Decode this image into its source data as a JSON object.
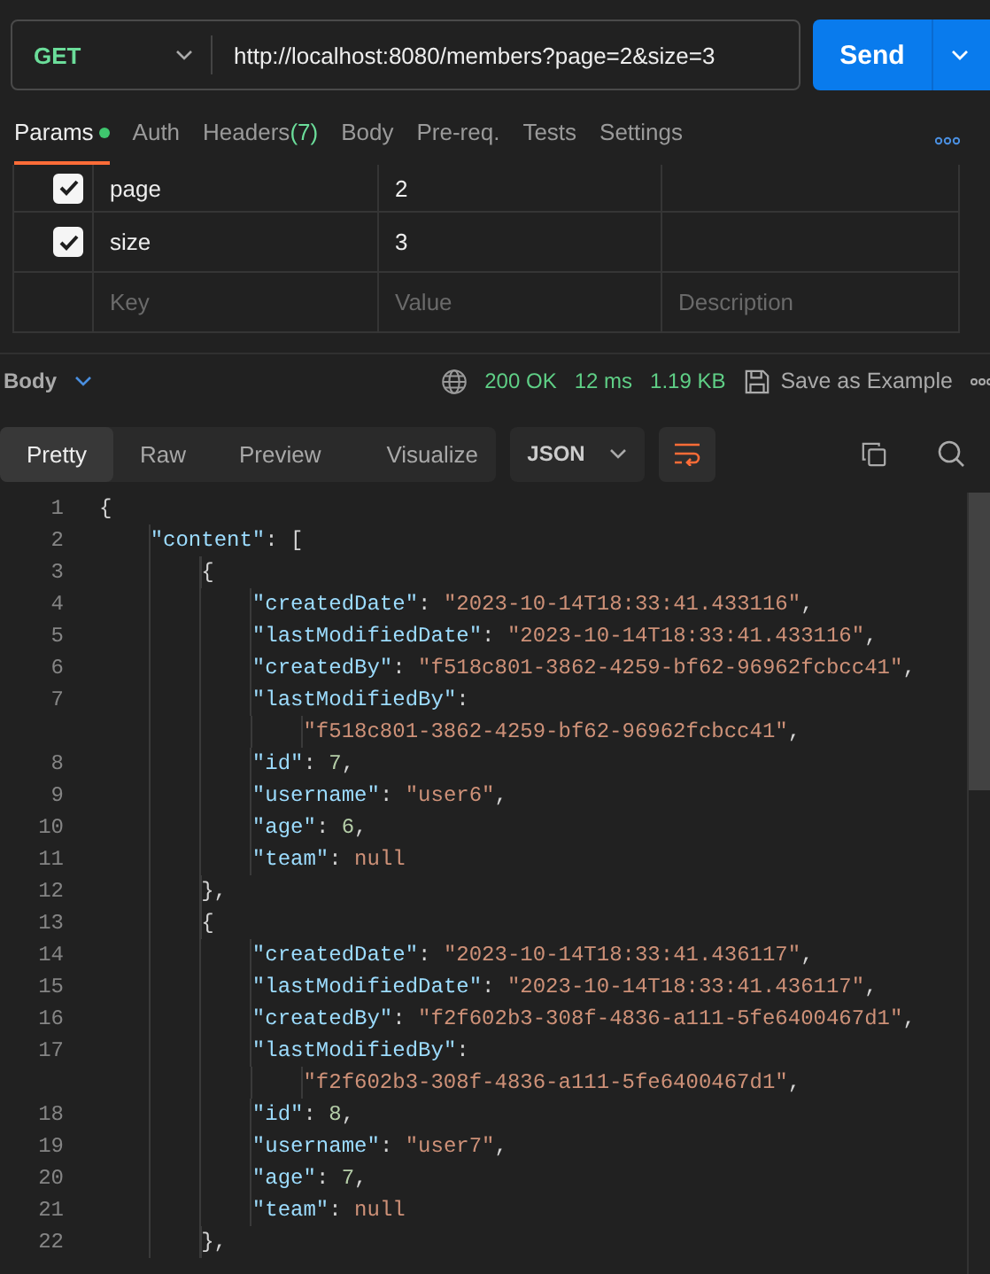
{
  "request": {
    "method": "GET",
    "url": "http://localhost:8080/members?page=2&size=3",
    "send_label": "Send"
  },
  "request_tabs": [
    {
      "label": "Params",
      "selected": true,
      "indicator": true
    },
    {
      "label": "Auth",
      "selected": false,
      "indicator": false
    },
    {
      "label": "Headers",
      "count": "(7)",
      "selected": false,
      "indicator": false
    },
    {
      "label": "Body",
      "selected": false,
      "indicator": false
    },
    {
      "label": "Pre-req.",
      "selected": false,
      "indicator": false
    },
    {
      "label": "Tests",
      "selected": false,
      "indicator": false
    },
    {
      "label": "Settings",
      "selected": false,
      "indicator": false
    }
  ],
  "params": {
    "rows": [
      {
        "checked": true,
        "key": "page",
        "value": "2"
      },
      {
        "checked": true,
        "key": "size",
        "value": "3"
      }
    ],
    "new_row": {
      "key_placeholder": "Key",
      "value_placeholder": "Value",
      "description_placeholder": "Description"
    }
  },
  "response": {
    "section": "Body",
    "status": "200 OK",
    "time": "12 ms",
    "size": "1.19 KB",
    "save_label": "Save as Example"
  },
  "view_tabs": [
    {
      "label": "Pretty",
      "selected": true
    },
    {
      "label": "Raw",
      "selected": false
    },
    {
      "label": "Preview",
      "selected": false
    },
    {
      "label": "Visualize",
      "selected": false
    }
  ],
  "format": "JSON",
  "wrap_on": true,
  "code_lines": [
    {
      "number": "1",
      "tokens": [
        {
          "kind": "punct",
          "text": "{"
        }
      ]
    },
    {
      "number": "2",
      "tokens": [
        {
          "kind": "key",
          "text": "    \"content\""
        },
        {
          "kind": "punct",
          "text": ": ["
        }
      ]
    },
    {
      "number": "3",
      "tokens": [
        {
          "kind": "punct",
          "text": "        {"
        }
      ]
    },
    {
      "number": "4",
      "tokens": [
        {
          "kind": "key",
          "text": "            \"createdDate\""
        },
        {
          "kind": "punct",
          "text": ": "
        },
        {
          "kind": "string",
          "text": "\"2023-10-14T18:33:41.433116\""
        },
        {
          "kind": "punct",
          "text": ","
        }
      ]
    },
    {
      "number": "5",
      "tokens": [
        {
          "kind": "key",
          "text": "            \"lastModifiedDate\""
        },
        {
          "kind": "punct",
          "text": ": "
        },
        {
          "kind": "string",
          "text": "\"2023-10-14T18:33:41.433116\""
        },
        {
          "kind": "punct",
          "text": ","
        }
      ]
    },
    {
      "number": "6",
      "tokens": [
        {
          "kind": "key",
          "text": "            \"createdBy\""
        },
        {
          "kind": "punct",
          "text": ": "
        },
        {
          "kind": "string",
          "text": "\"f518c801-3862-4259-bf62-96962fcbcc41\""
        },
        {
          "kind": "punct",
          "text": ","
        }
      ]
    },
    {
      "number": "7",
      "tokens": [
        {
          "kind": "key",
          "text": "            \"lastModifiedBy\""
        },
        {
          "kind": "punct",
          "text": ":"
        }
      ]
    },
    {
      "tokens": [
        {
          "kind": "string",
          "text": "                \"f518c801-3862-4259-bf62-96962fcbcc41\""
        },
        {
          "kind": "punct",
          "text": ","
        }
      ]
    },
    {
      "number": "8",
      "tokens": [
        {
          "kind": "key",
          "text": "            \"id\""
        },
        {
          "kind": "punct",
          "text": ": "
        },
        {
          "kind": "number",
          "text": "7"
        },
        {
          "kind": "punct",
          "text": ","
        }
      ]
    },
    {
      "number": "9",
      "tokens": [
        {
          "kind": "key",
          "text": "            \"username\""
        },
        {
          "kind": "punct",
          "text": ": "
        },
        {
          "kind": "string",
          "text": "\"user6\""
        },
        {
          "kind": "punct",
          "text": ","
        }
      ]
    },
    {
      "number": "10",
      "tokens": [
        {
          "kind": "key",
          "text": "            \"age\""
        },
        {
          "kind": "punct",
          "text": ": "
        },
        {
          "kind": "number",
          "text": "6"
        },
        {
          "kind": "punct",
          "text": ","
        }
      ]
    },
    {
      "number": "11",
      "tokens": [
        {
          "kind": "key",
          "text": "            \"team\""
        },
        {
          "kind": "punct",
          "text": ": "
        },
        {
          "kind": "null",
          "text": "null"
        }
      ]
    },
    {
      "number": "12",
      "tokens": [
        {
          "kind": "punct",
          "text": "        },"
        }
      ]
    },
    {
      "number": "13",
      "tokens": [
        {
          "kind": "punct",
          "text": "        {"
        }
      ]
    },
    {
      "number": "14",
      "tokens": [
        {
          "kind": "key",
          "text": "            \"createdDate\""
        },
        {
          "kind": "punct",
          "text": ": "
        },
        {
          "kind": "string",
          "text": "\"2023-10-14T18:33:41.436117\""
        },
        {
          "kind": "punct",
          "text": ","
        }
      ]
    },
    {
      "number": "15",
      "tokens": [
        {
          "kind": "key",
          "text": "            \"lastModifiedDate\""
        },
        {
          "kind": "punct",
          "text": ": "
        },
        {
          "kind": "string",
          "text": "\"2023-10-14T18:33:41.436117\""
        },
        {
          "kind": "punct",
          "text": ","
        }
      ]
    },
    {
      "number": "16",
      "tokens": [
        {
          "kind": "key",
          "text": "            \"createdBy\""
        },
        {
          "kind": "punct",
          "text": ": "
        },
        {
          "kind": "string",
          "text": "\"f2f602b3-308f-4836-a111-5fe6400467d1\""
        },
        {
          "kind": "punct",
          "text": ","
        }
      ]
    },
    {
      "number": "17",
      "tokens": [
        {
          "kind": "key",
          "text": "            \"lastModifiedBy\""
        },
        {
          "kind": "punct",
          "text": ":"
        }
      ]
    },
    {
      "tokens": [
        {
          "kind": "string",
          "text": "                \"f2f602b3-308f-4836-a111-5fe6400467d1\""
        },
        {
          "kind": "punct",
          "text": ","
        }
      ]
    },
    {
      "number": "18",
      "tokens": [
        {
          "kind": "key",
          "text": "            \"id\""
        },
        {
          "kind": "punct",
          "text": ": "
        },
        {
          "kind": "number",
          "text": "8"
        },
        {
          "kind": "punct",
          "text": ","
        }
      ]
    },
    {
      "number": "19",
      "tokens": [
        {
          "kind": "key",
          "text": "            \"username\""
        },
        {
          "kind": "punct",
          "text": ": "
        },
        {
          "kind": "string",
          "text": "\"user7\""
        },
        {
          "kind": "punct",
          "text": ","
        }
      ]
    },
    {
      "number": "20",
      "tokens": [
        {
          "kind": "key",
          "text": "            \"age\""
        },
        {
          "kind": "punct",
          "text": ": "
        },
        {
          "kind": "number",
          "text": "7"
        },
        {
          "kind": "punct",
          "text": ","
        }
      ]
    },
    {
      "number": "21",
      "tokens": [
        {
          "kind": "key",
          "text": "            \"team\""
        },
        {
          "kind": "punct",
          "text": ": "
        },
        {
          "kind": "null",
          "text": "null"
        }
      ]
    },
    {
      "number": "22",
      "tokens": [
        {
          "kind": "punct",
          "text": "        },"
        }
      ]
    }
  ]
}
